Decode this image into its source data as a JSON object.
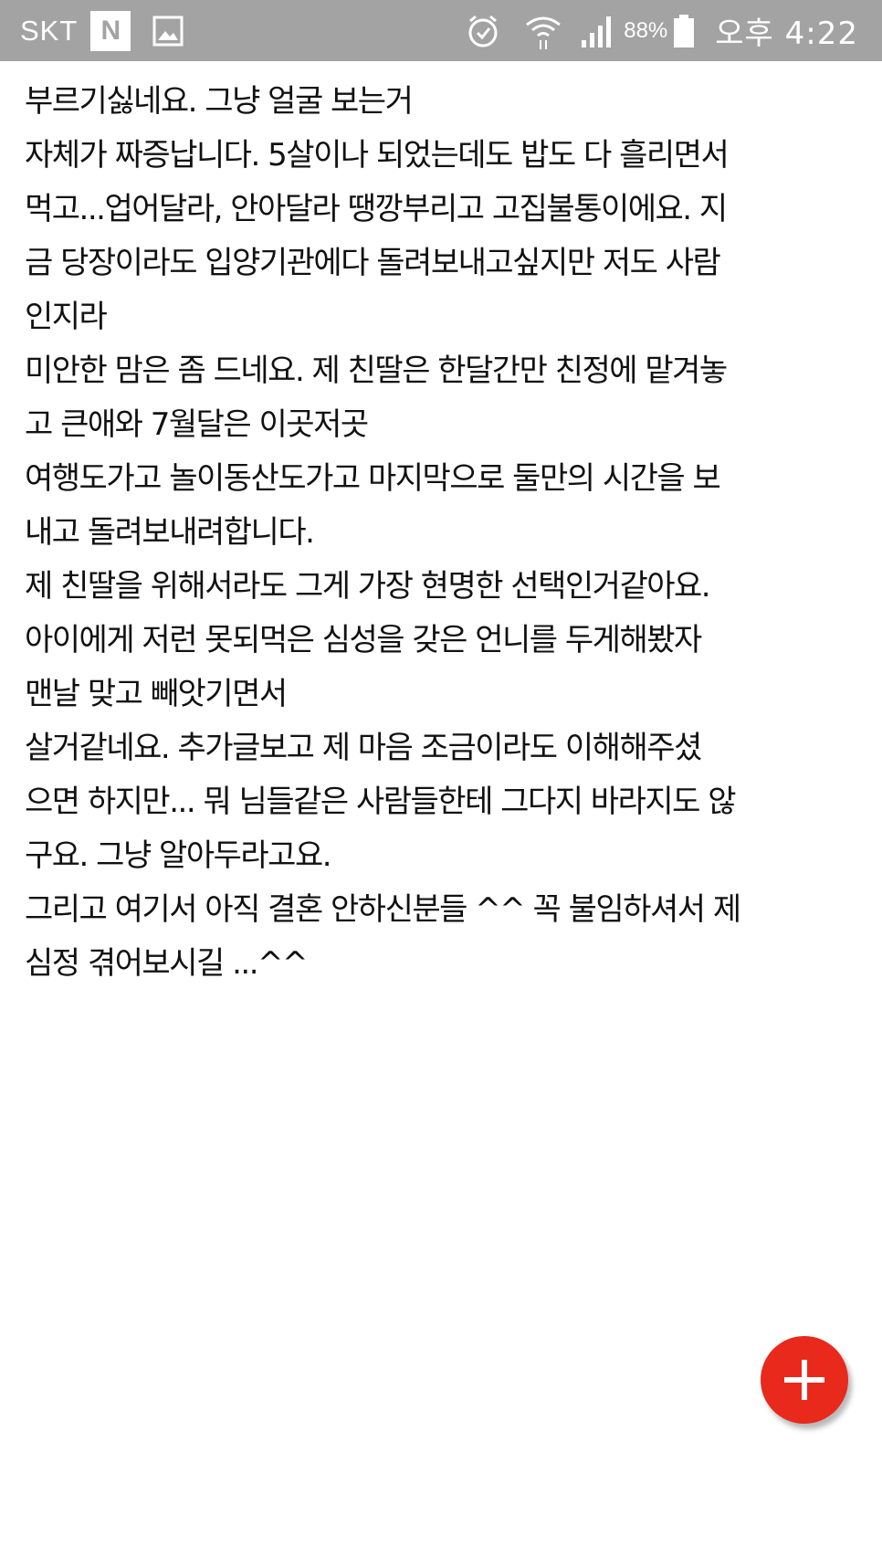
{
  "status_bar": {
    "carrier": "SKT",
    "notification_icons": [
      "n-app-icon",
      "gallery-icon"
    ],
    "system_icons": [
      "alarm-icon",
      "wifi-icon",
      "signal-icon",
      "battery-icon"
    ],
    "battery": "88%",
    "time": "오후 4:22"
  },
  "post": {
    "lines": [
      "부르기싫네요. 그냥 얼굴 보는거",
      "자체가 짜증납니다. 5살이나 되었는데도 밥도 다 흘리면서",
      "먹고...업어달라, 안아달라 땡깡부리고 고집불통이에요. 지",
      "금 당장이라도 입양기관에다 돌려보내고싶지만 저도 사람",
      "인지라",
      "미안한 맘은 좀 드네요. 제 친딸은 한달간만 친정에 맡겨놓",
      "고 큰애와 7월달은 이곳저곳",
      "여행도가고 놀이동산도가고 마지막으로 둘만의 시간을 보",
      "내고 돌려보내려합니다.",
      "제 친딸을 위해서라도 그게 가장 현명한 선택인거같아요.",
      "아이에게 저런 못되먹은 심성을 갖은 언니를 두게해봤자",
      "맨날 맞고 빼앗기면서",
      "살거같네요.  추가글보고 제 마음 조금이라도 이해해주셨",
      "으면 하지만... 뭐 님들같은 사람들한테 그다지 바라지도 않",
      "구요. 그냥 알아두라고요.",
      "그리고 여기서 아직 결혼 안하신분들 ^^ 꼭 불임하셔서 제",
      "심정 겪어보시길 ...^^"
    ]
  },
  "fab": {
    "icon": "plus-icon",
    "color": "#e8291b"
  },
  "colors": {
    "status_bar_bg": "#a3a3a3",
    "text": "#111111",
    "background": "#ffffff"
  }
}
